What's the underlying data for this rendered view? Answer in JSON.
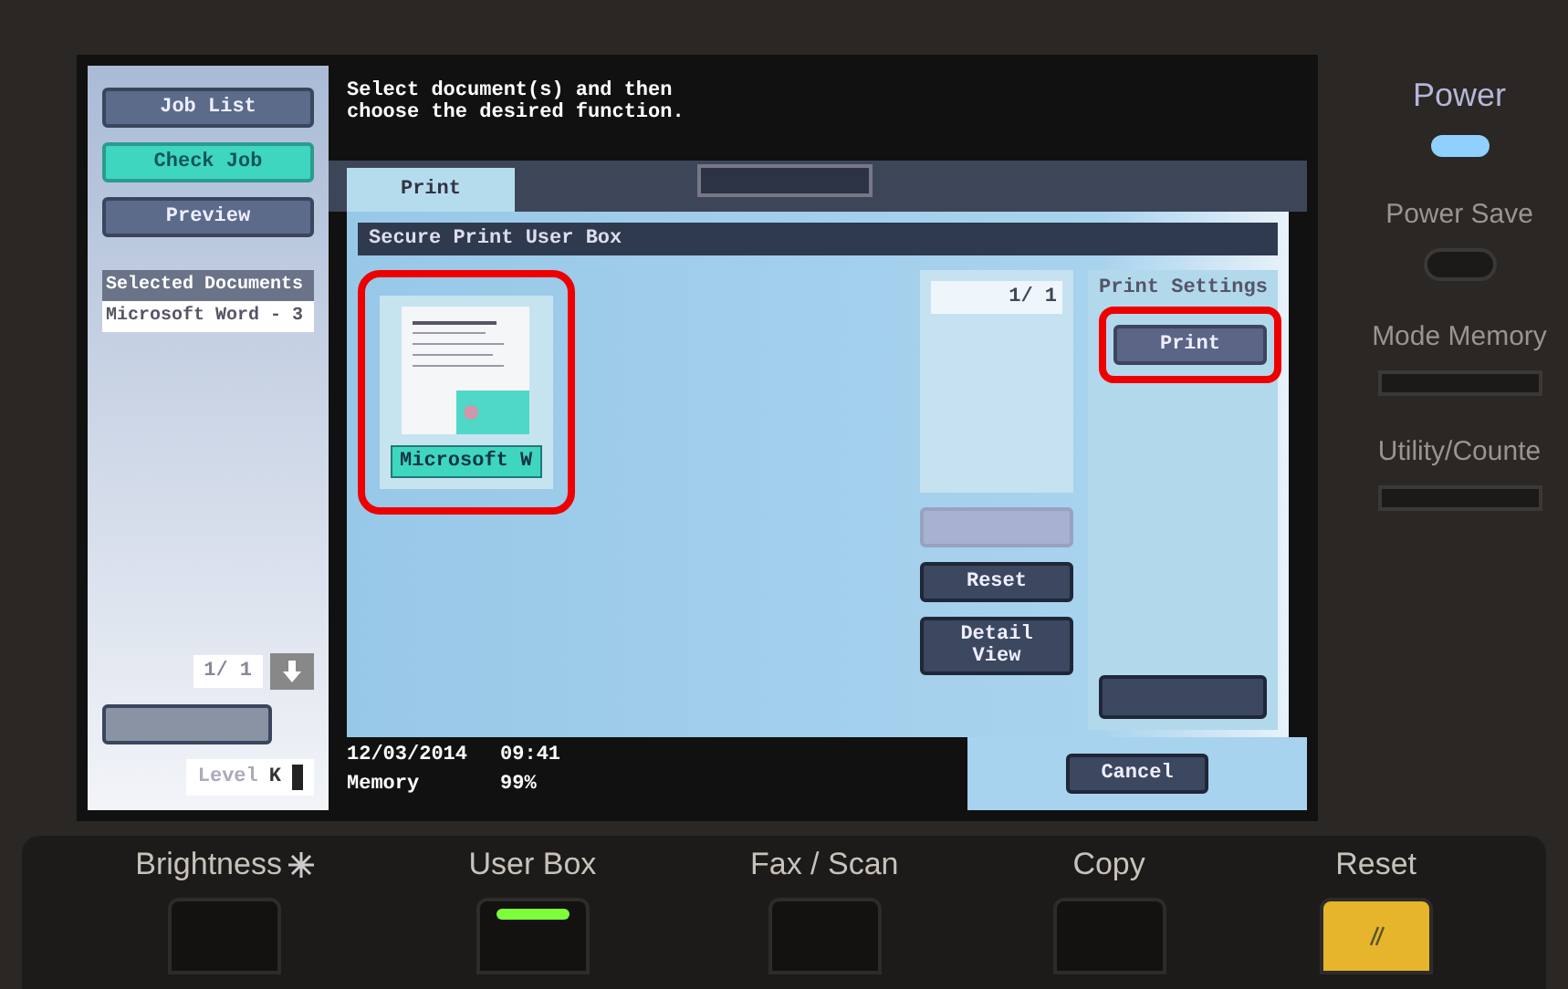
{
  "sidebar": {
    "buttons": [
      {
        "label": "Job List",
        "selected": false
      },
      {
        "label": "Check Job",
        "selected": true
      },
      {
        "label": "Preview",
        "selected": false
      }
    ],
    "selected_heading": "Selected Documents",
    "selected_items": [
      "Microsoft Word - 3"
    ],
    "page_counter": "1/ 1",
    "level_label": "Level",
    "toner": "K"
  },
  "message": [
    "Select document(s) and then",
    "choose the desired function."
  ],
  "tabs": [
    {
      "label": "Print",
      "selected": true
    },
    {
      "selected": false
    }
  ],
  "box_title": "Secure Print User Box",
  "documents": [
    {
      "name": "Microsoft W",
      "selected": true
    }
  ],
  "page_counter": "1/ 1",
  "actions": [
    {
      "disabled": true
    },
    {
      "label": "Reset",
      "disabled": false
    },
    {
      "label": "Detail View",
      "disabled": false
    }
  ],
  "print_settings": {
    "heading": "Print Settings",
    "button": "Print"
  },
  "status": {
    "date": "12/03/2014",
    "time": "09:41",
    "memory_label": "Memory",
    "memory": "99%"
  },
  "cancel": "Cancel",
  "panel": {
    "power": "Power",
    "power_save": "Power Save",
    "mode_memory": "Mode Memory",
    "utility": "Utility/Counte"
  },
  "keys": [
    {
      "label": "Brightness",
      "kind": "brightness",
      "lit": false
    },
    {
      "label": "User Box",
      "kind": "mode",
      "lit": true
    },
    {
      "label": "Fax / Scan",
      "kind": "mode",
      "lit": false
    },
    {
      "label": "Copy",
      "kind": "mode",
      "lit": false
    },
    {
      "label": "Reset",
      "kind": "reset",
      "lit": false
    }
  ]
}
